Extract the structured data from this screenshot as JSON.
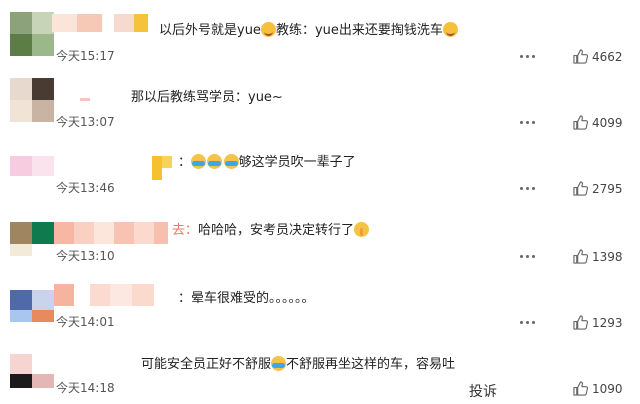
{
  "comments": [
    {
      "text_before": "以后外号就是yue",
      "emoji_mid": "smile-emoji",
      "text_after": "教练：yue出来还要掏钱洗车",
      "emoji_end": "smile-emoji",
      "time": "今天15:17",
      "likes": "4662"
    },
    {
      "text": "那以后教练骂学员：yue~",
      "time": "今天13:07",
      "likes": "4099"
    },
    {
      "emojis": [
        "cry-laugh-emoji",
        "cry-laugh-emoji",
        "cry-laugh-emoji"
      ],
      "text": "够这学员吹一辈子了",
      "time": "今天13:46",
      "likes": "2795"
    },
    {
      "prefix": "去：",
      "text": "哈哈哈，安考员决定转行了",
      "emoji_end": "shush-emoji",
      "time": "今天13:10",
      "likes": "1398"
    },
    {
      "text": "：晕车很难受的。。。。。。",
      "time": "今天14:01",
      "likes": "1293"
    },
    {
      "text_before": "可能安全员正好不舒服",
      "emoji_mid": "cry-laugh-emoji",
      "text_after": "不舒服再坐这样的车，容易吐",
      "time": "今天14:18",
      "likes": "1090"
    }
  ],
  "report_label": "投诉"
}
